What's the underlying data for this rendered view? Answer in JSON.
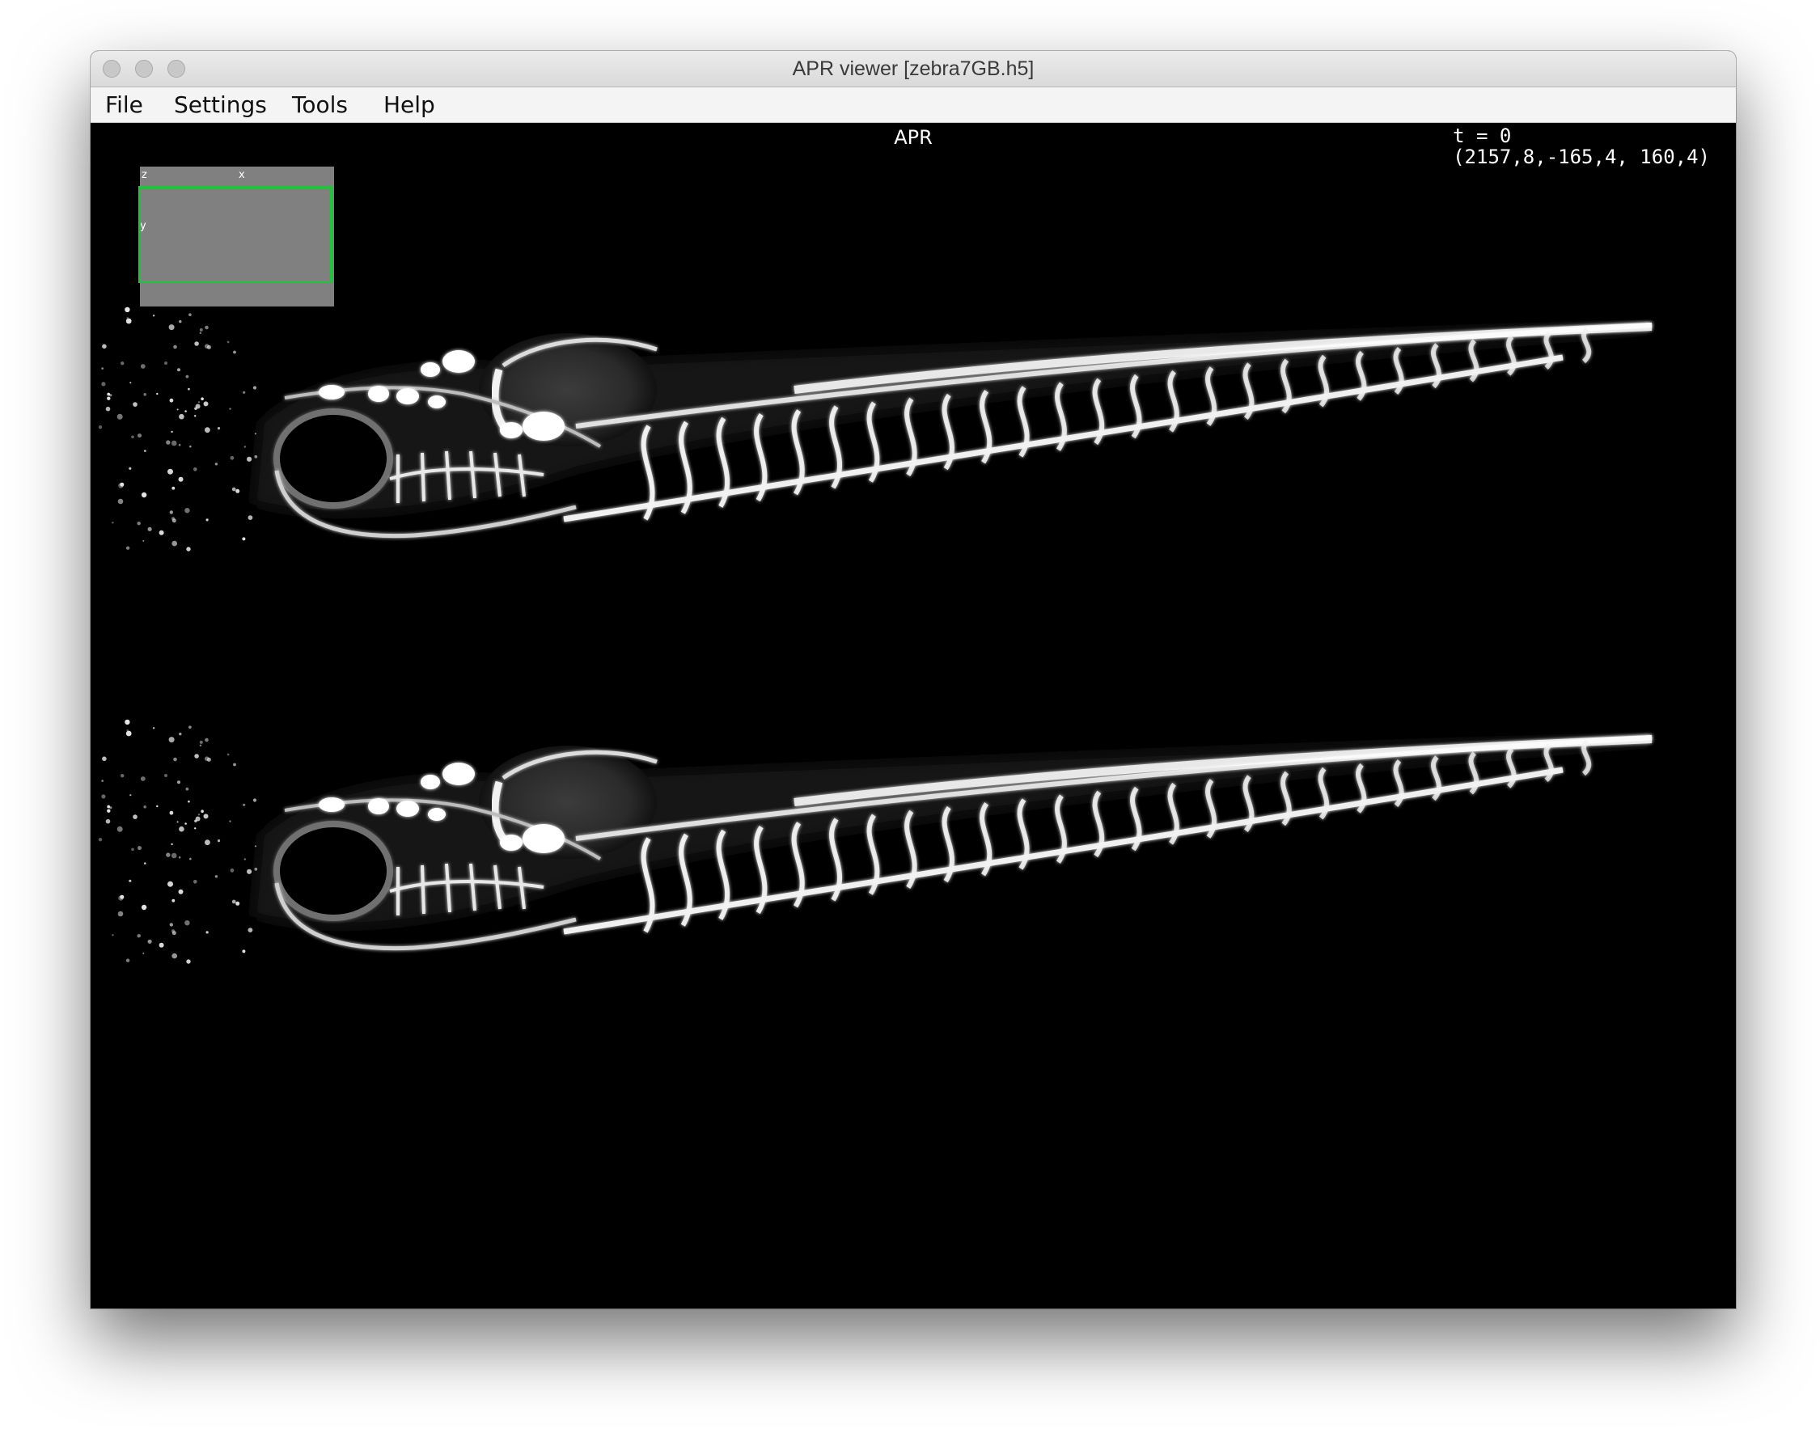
{
  "window": {
    "title": "APR viewer [zebra7GB.h5]"
  },
  "menu": {
    "items": [
      {
        "label": "File"
      },
      {
        "label": "Settings"
      },
      {
        "label": "Tools"
      },
      {
        "label": "Help"
      }
    ]
  },
  "viewer": {
    "label": "APR",
    "time": "t = 0",
    "coords": "(2157,8,-165,4, 160,4)"
  },
  "minimap": {
    "axis_z": "z",
    "axis_x": "x",
    "axis_y": "y",
    "frame_color": "#22c23a"
  },
  "colors": {
    "background": "#000000",
    "specimen": "#ffffff",
    "minimap": "#808080"
  }
}
